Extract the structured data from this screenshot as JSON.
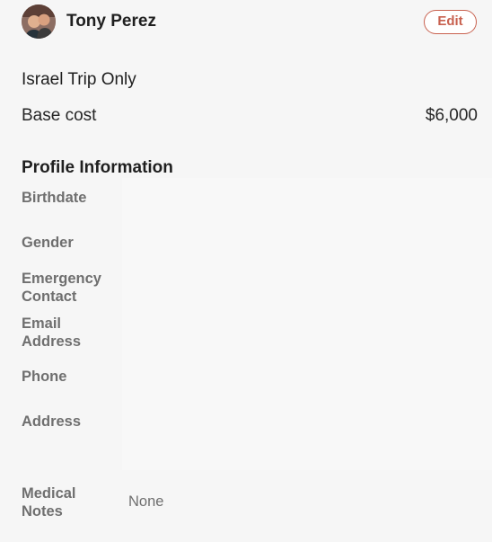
{
  "header": {
    "name": "Tony Perez",
    "edit_label": "Edit"
  },
  "trip": {
    "name": "Israel Trip Only",
    "base_cost_label": "Base cost",
    "base_cost_value": "$6,000"
  },
  "profile": {
    "title": "Profile Information",
    "fields": [
      {
        "label": "Birthdate",
        "value": ""
      },
      {
        "label": "Gender",
        "value": ""
      },
      {
        "label": "Emergency\nContact",
        "value": ""
      },
      {
        "label": "Email\nAddress",
        "value": ""
      },
      {
        "label": "Phone",
        "value": ""
      },
      {
        "label": "Address",
        "value": ""
      },
      {
        "label": "Medical\nNotes",
        "value": "None"
      }
    ]
  },
  "colors": {
    "accent": "#c8614f",
    "background": "#f6f6f6",
    "label": "#6f6f6f"
  }
}
